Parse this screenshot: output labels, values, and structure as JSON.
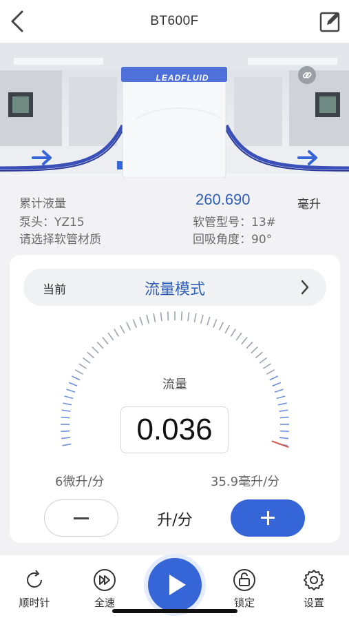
{
  "header": {
    "title": "BT600F",
    "back_icon": "chevron-left-icon",
    "edit_icon": "edit-icon"
  },
  "hero": {
    "brand": "LEADFLUID",
    "link_icon": "link-icon",
    "arrow_icon": "arrow-right-icon"
  },
  "info": {
    "volume_label": "累计液量",
    "volume_value": "260.690",
    "volume_unit": "毫升",
    "pump_head": "泵头：YZ15",
    "tube_model": "软管型号：13#",
    "tube_material": "请选择软管材质",
    "suckback_angle": "回吸角度：90°"
  },
  "mode": {
    "prefix": "当前",
    "value": "流量模式"
  },
  "gauge": {
    "label": "流量",
    "value": "0.036",
    "min_label": "6微升/分",
    "max_label": "35.9毫升/分",
    "level": 0.001,
    "accent": "#3565d6",
    "indicator_color": "#d9534f"
  },
  "controls": {
    "unit": "升/分",
    "minus_icon": "minus-icon",
    "plus_icon": "plus-icon"
  },
  "bottom": {
    "items": [
      {
        "label": "顺时针",
        "icon": "rotate-clockwise-icon"
      },
      {
        "label": "全速",
        "icon": "fast-forward-icon"
      },
      {
        "label": "锁定",
        "icon": "unlock-icon"
      },
      {
        "label": "设置",
        "icon": "gear-icon"
      }
    ],
    "play_icon": "play-icon"
  },
  "colors": {
    "primary": "#3565d6",
    "value_text": "#2f5fb8"
  }
}
